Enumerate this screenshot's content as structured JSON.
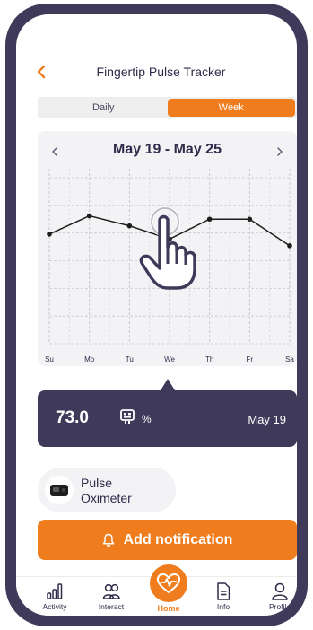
{
  "header": {
    "title": "Fingertip Pulse Tracker",
    "back_icon": "chevron-left-icon"
  },
  "segments": [
    {
      "label": "Daily",
      "active": false
    },
    {
      "label": "Week",
      "active": true
    }
  ],
  "chart_card": {
    "date_range": "May 19 - May 25",
    "prev_icon": "chevron-left-icon",
    "next_icon": "chevron-right-icon"
  },
  "chart_data": {
    "type": "line",
    "categories": [
      "Su",
      "Mo",
      "Tu",
      "We",
      "Th",
      "Fr",
      "Sa"
    ],
    "values": [
      73.0,
      78.5,
      75.5,
      71.5,
      77.5,
      77.5,
      69.5
    ],
    "ylim": [
      40,
      90
    ],
    "grid": true,
    "line_color": "#1e1e1e",
    "grid_color": "#c9c9cc"
  },
  "gesture_icon": "tap-hand-icon",
  "reading": {
    "value": "73.0",
    "unit": "%",
    "date": "May 19",
    "icon": "monitor-icon"
  },
  "device": {
    "name": "Pulse Oximeter",
    "icon": "pulse-oximeter-icon"
  },
  "actions": {
    "add_notification": "Add notification",
    "bell_icon": "bell-icon"
  },
  "bottom_nav": [
    {
      "label": "Activity",
      "icon": "bar-chart-icon"
    },
    {
      "label": "Interact",
      "icon": "people-icon"
    },
    {
      "label": "Home",
      "icon": "heart-pulse-icon",
      "active": true
    },
    {
      "label": "Info",
      "icon": "document-icon"
    },
    {
      "label": "Profile",
      "icon": "user-icon"
    }
  ],
  "colors": {
    "accent": "#f07d1d",
    "dark": "#3f3a5a",
    "card": "#f3f3f6"
  }
}
